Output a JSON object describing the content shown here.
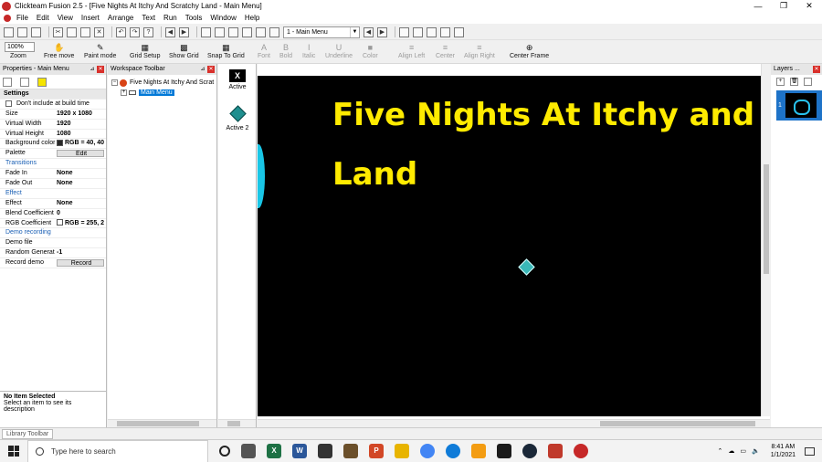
{
  "window": {
    "title": "Clickteam Fusion 2.5 - [Five Nights At Itchy And Scratchy Land - Main Menu]",
    "controls": [
      "—",
      "❐",
      "✕"
    ]
  },
  "menu": [
    "File",
    "Edit",
    "View",
    "Insert",
    "Arrange",
    "Text",
    "Run",
    "Tools",
    "Window",
    "Help"
  ],
  "toolbar": {
    "frame_select": "1 - Main Menu",
    "zoom": "100%",
    "zoom_label": "Zoom",
    "free_move": "Free move",
    "paint_mode": "Paint mode",
    "grid_setup": "Grid Setup",
    "show_grid": "Show Grid",
    "snap_to_grid": "Snap To Grid",
    "font": "Font",
    "bold": "Bold",
    "italic": "Italic",
    "underline": "Underline",
    "color": "Color",
    "align_left": "Align Left",
    "center": "Center",
    "align_right": "Align Right",
    "center_frame": "Center Frame"
  },
  "properties": {
    "title": "Properties - Main Menu",
    "section_settings": "Settings",
    "dont_include": "Don't include at build time",
    "size_label": "Size",
    "size_value": "1920 x 1080",
    "vwidth_label": "Virtual Width",
    "vwidth_value": "1920",
    "vheight_label": "Virtual Height",
    "vheight_value": "1080",
    "bgcolor_label": "Background color",
    "bgcolor_value": "RGB = 40, 40",
    "palette_label": "Palette",
    "palette_button": "Edit",
    "cat_transitions": "Transitions",
    "fadein_label": "Fade In",
    "fadein_value": "None",
    "fadeout_label": "Fade Out",
    "fadeout_value": "None",
    "cat_effect": "Effect",
    "effect_label": "Effect",
    "effect_value": "None",
    "blend_label": "Blend Coefficient",
    "blend_value": "0",
    "rgbcoef_label": "RGB Coefficient",
    "rgbcoef_value": "RGB = 255, 2",
    "cat_demo": "Demo recording",
    "demofile_label": "Demo file",
    "demofile_value": "",
    "random_label": "Random Generator",
    "random_value": "-1",
    "record_label": "Record demo",
    "record_button": "Record",
    "info_title": "No Item Selected",
    "info_text": "Select an item to see its description",
    "bgcolor_hex": "#282828",
    "rgbcoef_hex": "#ffffff"
  },
  "workspace": {
    "title": "Workspace Toolbar",
    "game": "Five Nights At Itchy And Scrat",
    "frame": "Main Menu"
  },
  "objects": [
    {
      "label": "Active",
      "icon": "active-object-icon"
    },
    {
      "label": "Active 2",
      "icon": "diamond-icon"
    }
  ],
  "frame_editor": {
    "title_line1": "Five Nights At Itchy and Scratchy",
    "title_line2": "Land",
    "title_color": "#ffeb00",
    "background": "#000000"
  },
  "layers": {
    "title": "Layers ...",
    "layer_number": "1"
  },
  "statusbar": {
    "library_tab": "Library Toolbar"
  },
  "taskbar": {
    "search_placeholder": "Type here to search",
    "time": "8:41 AM",
    "date": "1/1/2021"
  }
}
